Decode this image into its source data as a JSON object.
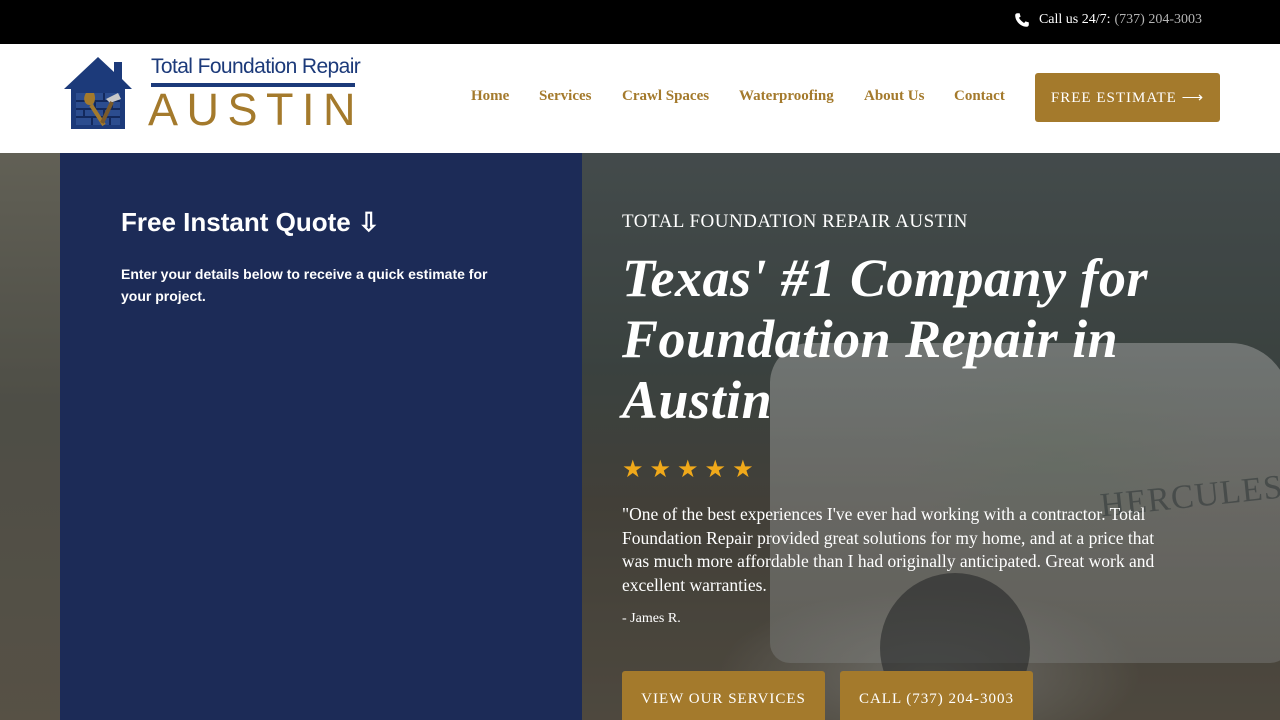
{
  "topbar": {
    "call_label": "Call us 24/7:",
    "phone": "(737) 204-3003",
    "icon": "phone-icon"
  },
  "logo": {
    "line1": "Total Foundation Repair",
    "line2": "AUSTIN",
    "icon": "house-tools-icon",
    "colors": {
      "navy": "#1c3a7a",
      "gold": "#a47a2c"
    }
  },
  "nav": {
    "items": [
      "Home",
      "Services",
      "Crawl Spaces",
      "Waterproofing",
      "About Us",
      "Contact"
    ],
    "cta": "FREE ESTIMATE ⟶"
  },
  "quote_panel": {
    "title": "Free Instant Quote ⇩",
    "description": "Enter your details below to receive a quick estimate for your project."
  },
  "hero": {
    "eyebrow": "TOTAL FOUNDATION REPAIR AUSTIN",
    "headline": "Texas' #1 Company for Foundation Repair in Austin",
    "rating": {
      "stars": 5,
      "display": "★★★★★",
      "color": "#f0a91a"
    },
    "testimonial": "\"One of the best experiences I've ever had working with a contractor. Total Foundation Repair provided great solutions for my home, and at a price that was much more affordable than I had originally anticipated. Great work and excellent warranties.",
    "author": "- James R.",
    "buttons": {
      "services": "VIEW OUR SERVICES",
      "call": "CALL (737) 204-3003"
    },
    "background_text": "HERCULES"
  },
  "colors": {
    "gold": "#a47a2c",
    "panel_navy": "#1c2b57",
    "topbar": "#000000"
  }
}
